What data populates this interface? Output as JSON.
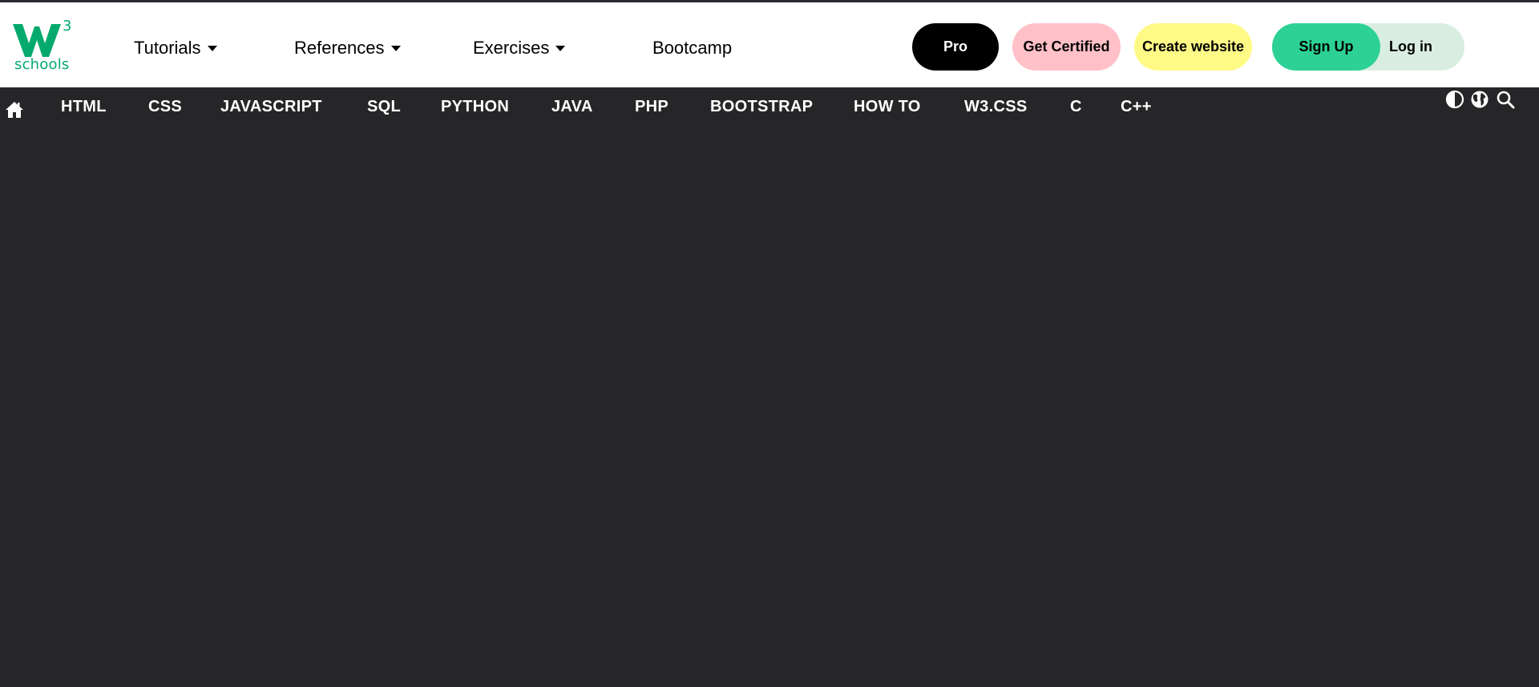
{
  "brand": {
    "logo_text": "schools",
    "logo_superscript": "3",
    "logo_mark": "W",
    "brand_color": "#04aa6d"
  },
  "top_nav": {
    "menus": [
      {
        "label": "Tutorials",
        "icon": "caret-down-icon"
      },
      {
        "label": "References",
        "icon": "caret-down-icon"
      },
      {
        "label": "Exercises",
        "icon": "caret-down-icon"
      },
      {
        "label": "Bootcamp"
      }
    ],
    "buttons": {
      "pro": "Pro",
      "get_certified": "Get Certified",
      "create_website": "Create website",
      "sign_up": "Sign Up",
      "log_in": "Log in"
    }
  },
  "sub_nav": {
    "home_icon": "home-icon",
    "links": [
      "HTML",
      "CSS",
      "JAVASCRIPT",
      "SQL",
      "PYTHON",
      "JAVA",
      "PHP",
      "BOOTSTRAP",
      "HOW TO",
      "W3.CSS",
      "C",
      "C++"
    ],
    "tools": [
      "contrast-icon",
      "globe-icon",
      "search-icon"
    ]
  },
  "colors": {
    "dark_bg": "#262628",
    "pro_bg": "#000000",
    "certified_bg": "#ffc0c7",
    "create_bg": "#fff986",
    "signup_bg": "#2dd195",
    "login_bg": "#d9eee1"
  }
}
